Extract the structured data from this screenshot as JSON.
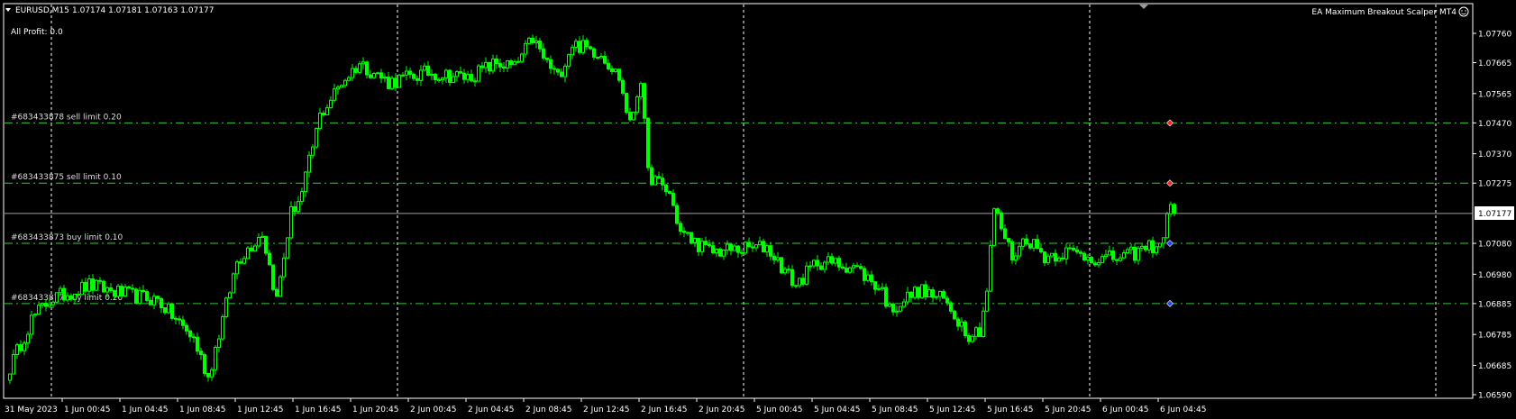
{
  "header": {
    "symbol": "EURUSD,M15",
    "ohlc": "1.07174 1.07181 1.07163 1.07177",
    "all_profit": "All Profit: 0.0",
    "ea_name": "EA Maximum Breakout Scalper MT4",
    "ea_icon": "smiley-icon"
  },
  "colors": {
    "background": "#000000",
    "bull": "#00ff00",
    "grid": "#ffffff",
    "order_line": "#32cd32",
    "sell_marker": "#ff2020",
    "buy_marker": "#1e40ff",
    "bid_line": "#a0a0a0"
  },
  "current_price": "1.07177",
  "price_axis": [
    "1.07760",
    "1.07665",
    "1.07565",
    "1.07470",
    "1.07370",
    "1.07275",
    "1.07080",
    "1.06980",
    "1.06885",
    "1.06785",
    "1.06685",
    "1.06590"
  ],
  "time_axis": [
    "31 May 2023",
    "1 Jun 00:45",
    "1 Jun 04:45",
    "1 Jun 08:45",
    "1 Jun 12:45",
    "1 Jun 16:45",
    "1 Jun 20:45",
    "2 Jun 00:45",
    "2 Jun 04:45",
    "2 Jun 08:45",
    "2 Jun 12:45",
    "2 Jun 16:45",
    "2 Jun 20:45",
    "5 Jun 00:45",
    "5 Jun 04:45",
    "5 Jun 08:45",
    "5 Jun 12:45",
    "5 Jun 16:45",
    "5 Jun 20:45",
    "6 Jun 00:45",
    "6 Jun 04:45"
  ],
  "orders": [
    {
      "label": "#683433878 sell limit 0.20",
      "price": 1.0747,
      "type": "sell"
    },
    {
      "label": "#683433875 sell limit 0.10",
      "price": 1.07275,
      "type": "sell"
    },
    {
      "label": "#683433873 buy limit 0.10",
      "price": 1.0708,
      "type": "buy"
    },
    {
      "label": "#683433877 buy limit 0.20",
      "price": 1.06885,
      "type": "buy"
    }
  ],
  "chart_data": {
    "type": "candlestick",
    "title": "EURUSD,M15",
    "ylim": [
      1.0659,
      1.0776
    ],
    "approx_close_path": [
      [
        1,
        1.06677
      ],
      [
        7,
        1.06834
      ],
      [
        12,
        1.06897
      ],
      [
        23,
        1.06944
      ],
      [
        34,
        1.06912
      ],
      [
        42,
        1.06897
      ],
      [
        52,
        1.06771
      ],
      [
        56,
        1.06646
      ],
      [
        60,
        1.06834
      ],
      [
        64,
        1.07022
      ],
      [
        71,
        1.07116
      ],
      [
        75,
        1.06897
      ],
      [
        79,
        1.07179
      ],
      [
        82,
        1.07241
      ],
      [
        87,
        1.07492
      ],
      [
        93,
        1.07602
      ],
      [
        98,
        1.07664
      ],
      [
        106,
        1.07602
      ],
      [
        117,
        1.07633
      ],
      [
        128,
        1.07617
      ],
      [
        136,
        1.07664
      ],
      [
        141,
        1.07649
      ],
      [
        146,
        1.07743
      ],
      [
        149,
        1.0768
      ],
      [
        153,
        1.07617
      ],
      [
        157,
        1.07727
      ],
      [
        165,
        1.07696
      ],
      [
        170,
        1.07617
      ],
      [
        173,
        1.07461
      ],
      [
        176,
        1.07617
      ],
      [
        178,
        1.07304
      ],
      [
        184,
        1.07241
      ],
      [
        187,
        1.07116
      ],
      [
        195,
        1.07053
      ],
      [
        203,
        1.0706
      ],
      [
        211,
        1.07069
      ],
      [
        219,
        1.06944
      ],
      [
        225,
        1.07022
      ],
      [
        235,
        1.07006
      ],
      [
        243,
        1.06928
      ],
      [
        245,
        1.06865
      ],
      [
        253,
        1.06928
      ],
      [
        260,
        1.06897
      ],
      [
        267,
        1.06787
      ],
      [
        270,
        1.06802
      ],
      [
        272,
        1.06928
      ],
      [
        274,
        1.07194
      ],
      [
        279,
        1.07038
      ],
      [
        283,
        1.071
      ],
      [
        288,
        1.07038
      ],
      [
        294,
        1.07053
      ],
      [
        304,
        1.07028
      ],
      [
        311,
        1.07038
      ],
      [
        317,
        1.07069
      ],
      [
        321,
        1.07085
      ],
      [
        322,
        1.07194
      ],
      [
        324,
        1.07177
      ]
    ]
  }
}
